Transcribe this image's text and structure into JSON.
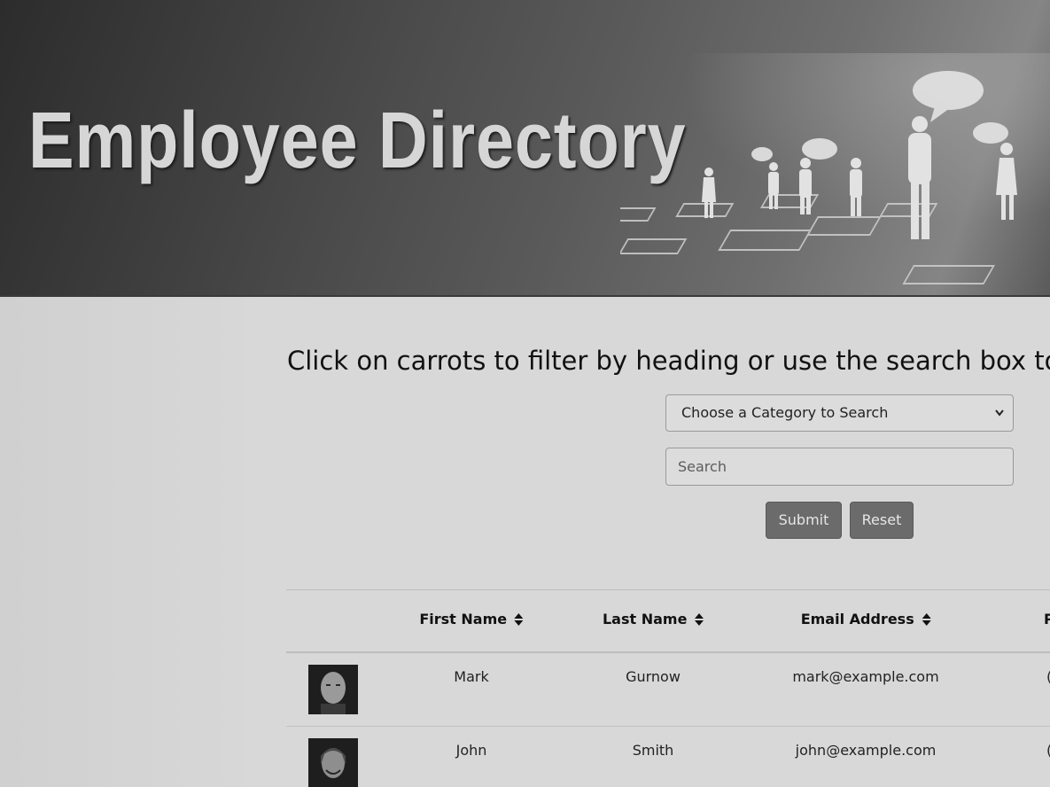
{
  "banner": {
    "title": "Employee Directory"
  },
  "instructions": {
    "text": "Click on carrots to filter by heading or use the search box to"
  },
  "search": {
    "category_label": "Choose a Category to Search",
    "placeholder": "Search",
    "value": "",
    "submit_label": "Submit",
    "reset_label": "Reset"
  },
  "table": {
    "headers": [
      "First Name",
      "Last Name",
      "Email Address",
      "Ph"
    ],
    "rows": [
      {
        "first": "Mark",
        "last": "Gurnow",
        "email": "mark@example.com",
        "phone": "("
      },
      {
        "first": "John",
        "last": "Smith",
        "email": "john@example.com",
        "phone": "("
      }
    ]
  },
  "icons": {
    "sort": "sort-caret-icon",
    "select": "chevron-down-icon"
  },
  "colors": {
    "banner_dark": "#2c2c2c",
    "title": "#d6d6d6",
    "button": "#6b6b6b",
    "page_bg": "#d8d8d8"
  }
}
